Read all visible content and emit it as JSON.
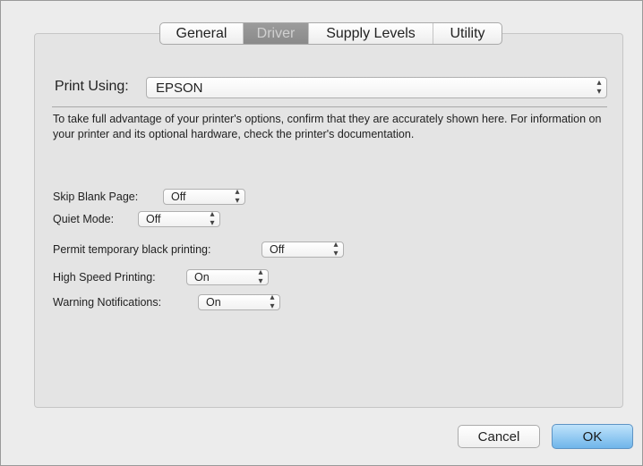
{
  "tabs": [
    {
      "label": "General",
      "active": false
    },
    {
      "label": "Driver",
      "active": true
    },
    {
      "label": "Supply Levels",
      "active": false
    },
    {
      "label": "Utility",
      "active": false
    }
  ],
  "print_using": {
    "label": "Print Using:",
    "value": "EPSON"
  },
  "description": "To take full advantage of your printer's options, confirm that they are accurately shown here. For information on your printer and its optional hardware, check the printer's documentation.",
  "options": [
    {
      "label": "Skip Blank Page:",
      "value": "Off"
    },
    {
      "label": "Quiet Mode:",
      "value": "Off"
    },
    {
      "label": "Permit temporary black printing:",
      "value": "Off"
    },
    {
      "label": "High Speed Printing:",
      "value": "On"
    },
    {
      "label": "Warning Notifications:",
      "value": "On"
    }
  ],
  "buttons": {
    "cancel": "Cancel",
    "ok": "OK"
  },
  "colors": {
    "active_tab": "#8f8f8f",
    "default_button": "#7dbcec",
    "panel": "#e4e4e4"
  }
}
